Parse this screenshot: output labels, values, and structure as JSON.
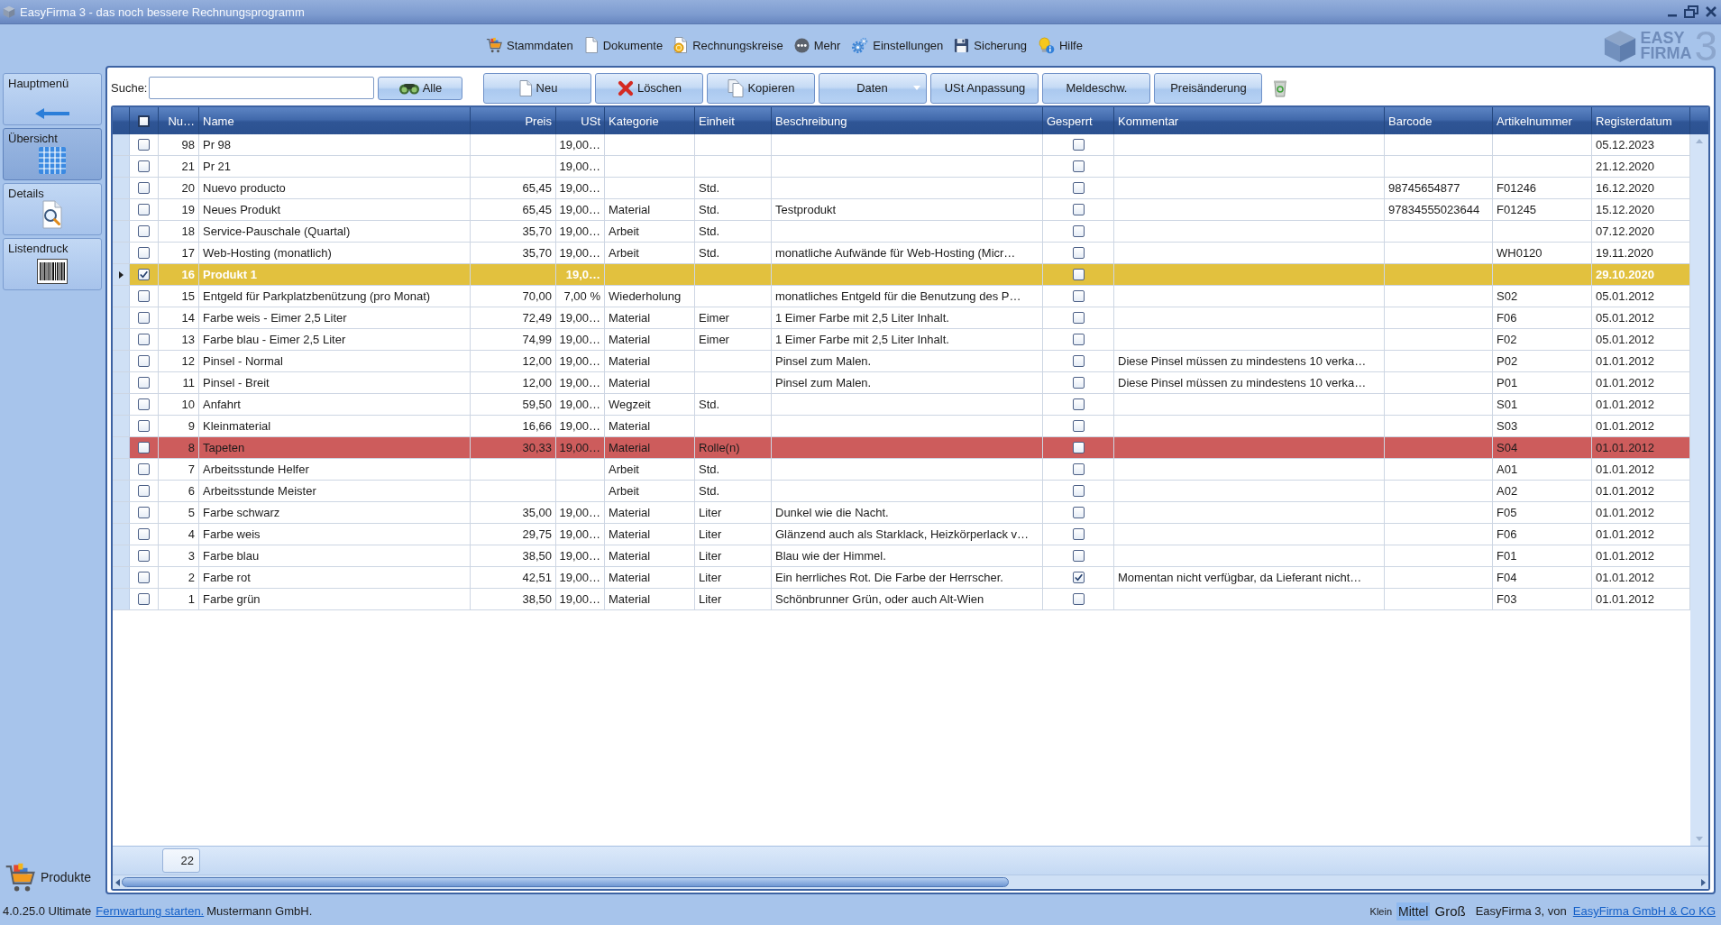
{
  "window": {
    "title": "EasyFirma 3 - das noch bessere Rechnungsprogramm"
  },
  "menu": [
    "Stammdaten",
    "Dokumente",
    "Rechnungskreise",
    "Mehr",
    "Einstellungen",
    "Sicherung",
    "Hilfe"
  ],
  "logo": {
    "words": [
      "EASY",
      "FIRMA"
    ],
    "numeral": "3"
  },
  "sidebar": {
    "items": [
      {
        "label": "Hauptmenü",
        "selected": false
      },
      {
        "label": "Übersicht",
        "selected": true
      },
      {
        "label": "Details",
        "selected": false
      },
      {
        "label": "Listendruck",
        "selected": false
      }
    ],
    "footer": "Produkte"
  },
  "toolbar": {
    "search_label": "Suche:",
    "filter_button": "Alle",
    "buttons": [
      {
        "label": "Neu",
        "kind": "button"
      },
      {
        "label": "Löschen",
        "kind": "button"
      },
      {
        "label": "Kopieren",
        "kind": "button"
      },
      {
        "label": "Daten",
        "kind": "dropdown"
      },
      {
        "label": "USt Anpassung",
        "kind": "button"
      },
      {
        "label": "Meldeschw.",
        "kind": "button"
      },
      {
        "label": "Preisänderung",
        "kind": "button"
      }
    ]
  },
  "table": {
    "select_all_checked": false,
    "columns": [
      "Nu…",
      "Name",
      "Preis",
      "USt",
      "Kategorie",
      "Einheit",
      "Beschreibung",
      "Gesperrt",
      "Kommentar",
      "Barcode",
      "Artikelnummer",
      "Registerdatum"
    ],
    "rows": [
      {
        "selected": false,
        "checked": false,
        "flagged": false,
        "nr": "98",
        "name": "Pr 98",
        "vat": "19,00…",
        "locked": false,
        "registered": "05.12.2023"
      },
      {
        "selected": false,
        "checked": false,
        "flagged": false,
        "nr": "21",
        "name": "Pr 21",
        "vat": "19,00…",
        "locked": false,
        "registered": "21.12.2020"
      },
      {
        "selected": false,
        "checked": false,
        "flagged": false,
        "nr": "20",
        "name": "Nuevo producto",
        "price": "65,45",
        "vat": "19,00…",
        "unit": "Std.",
        "locked": false,
        "barcode": "98745654877",
        "article_no": "F01246",
        "registered": "16.12.2020"
      },
      {
        "selected": false,
        "checked": false,
        "flagged": false,
        "nr": "19",
        "name": "Neues Produkt",
        "price": "65,45",
        "vat": "19,00…",
        "category": "Material",
        "unit": "Std.",
        "description": "Testprodukt",
        "locked": false,
        "barcode": "97834555023644",
        "article_no": "F01245",
        "registered": "15.12.2020"
      },
      {
        "selected": false,
        "checked": false,
        "flagged": false,
        "nr": "18",
        "name": "Service-Pauschale (Quartal)",
        "price": "35,70",
        "vat": "19,00…",
        "category": "Arbeit",
        "unit": "Std.",
        "locked": false,
        "registered": "07.12.2020"
      },
      {
        "selected": false,
        "checked": false,
        "flagged": false,
        "nr": "17",
        "name": "Web-Hosting (monatlich)",
        "price": "35,70",
        "vat": "19,00…",
        "category": "Arbeit",
        "unit": "Std.",
        "description": "monatliche Aufwände für Web-Hosting (Micr…",
        "locked": false,
        "article_no": "WH0120",
        "registered": "19.11.2020"
      },
      {
        "selected": true,
        "checked": true,
        "flagged": false,
        "nr": "16",
        "name": "Produkt 1",
        "vat": "19,0…",
        "locked": false,
        "registered": "29.10.2020"
      },
      {
        "selected": false,
        "checked": false,
        "flagged": false,
        "nr": "15",
        "name": "Entgeld für Parkplatzbenützung (pro Monat)",
        "price": "70,00",
        "vat": "7,00 %",
        "category": "Wiederholung",
        "description": "monatliches Entgeld für die Benutzung des P…",
        "locked": false,
        "article_no": "S02",
        "registered": "05.01.2012"
      },
      {
        "selected": false,
        "checked": false,
        "flagged": false,
        "nr": "14",
        "name": "Farbe weis - Eimer 2,5 Liter",
        "price": "72,49",
        "vat": "19,00…",
        "category": "Material",
        "unit": "Eimer",
        "description": "1 Eimer Farbe mit 2,5 Liter Inhalt.",
        "locked": false,
        "article_no": "F06",
        "registered": "05.01.2012"
      },
      {
        "selected": false,
        "checked": false,
        "flagged": false,
        "nr": "13",
        "name": "Farbe blau - Eimer 2,5 Liter",
        "price": "74,99",
        "vat": "19,00…",
        "category": "Material",
        "unit": "Eimer",
        "description": "1 Eimer Farbe mit 2,5 Liter Inhalt.",
        "locked": false,
        "article_no": "F02",
        "registered": "05.01.2012"
      },
      {
        "selected": false,
        "checked": false,
        "flagged": false,
        "nr": "12",
        "name": "Pinsel - Normal",
        "price": "12,00",
        "vat": "19,00…",
        "category": "Material",
        "description": "Pinsel zum Malen.",
        "locked": false,
        "comment": "Diese Pinsel müssen zu mindestens 10 verka…",
        "article_no": "P02",
        "registered": "01.01.2012"
      },
      {
        "selected": false,
        "checked": false,
        "flagged": false,
        "nr": "11",
        "name": "Pinsel - Breit",
        "price": "12,00",
        "vat": "19,00…",
        "category": "Material",
        "description": "Pinsel zum Malen.",
        "locked": false,
        "comment": "Diese Pinsel müssen zu mindestens 10 verka…",
        "article_no": "P01",
        "registered": "01.01.2012"
      },
      {
        "selected": false,
        "checked": false,
        "flagged": false,
        "nr": "10",
        "name": "Anfahrt",
        "price": "59,50",
        "vat": "19,00…",
        "category": "Wegzeit",
        "unit": "Std.",
        "locked": false,
        "article_no": "S01",
        "registered": "01.01.2012"
      },
      {
        "selected": false,
        "checked": false,
        "flagged": false,
        "nr": "9",
        "name": "Kleinmaterial",
        "price": "16,66",
        "vat": "19,00…",
        "category": "Material",
        "locked": false,
        "article_no": "S03",
        "registered": "01.01.2012"
      },
      {
        "selected": false,
        "checked": false,
        "flagged": true,
        "nr": "8",
        "name": "Tapeten",
        "price": "30,33",
        "vat": "19,00…",
        "category": "Material",
        "unit": "Rolle(n)",
        "locked": false,
        "article_no": "S04",
        "registered": "01.01.2012"
      },
      {
        "selected": false,
        "checked": false,
        "flagged": false,
        "nr": "7",
        "name": "Arbeitsstunde Helfer",
        "category": "Arbeit",
        "unit": "Std.",
        "locked": false,
        "article_no": "A01",
        "registered": "01.01.2012"
      },
      {
        "selected": false,
        "checked": false,
        "flagged": false,
        "nr": "6",
        "name": "Arbeitsstunde Meister",
        "category": "Arbeit",
        "unit": "Std.",
        "locked": false,
        "article_no": "A02",
        "registered": "01.01.2012"
      },
      {
        "selected": false,
        "checked": false,
        "flagged": false,
        "nr": "5",
        "name": "Farbe schwarz",
        "price": "35,00",
        "vat": "19,00…",
        "category": "Material",
        "unit": "Liter",
        "description": "Dunkel wie die Nacht.",
        "locked": false,
        "article_no": "F05",
        "registered": "01.01.2012"
      },
      {
        "selected": false,
        "checked": false,
        "flagged": false,
        "nr": "4",
        "name": "Farbe weis",
        "price": "29,75",
        "vat": "19,00…",
        "category": "Material",
        "unit": "Liter",
        "description": "Glänzend auch als Starklack, Heizkörperlack v…",
        "locked": false,
        "article_no": "F06",
        "registered": "01.01.2012"
      },
      {
        "selected": false,
        "checked": false,
        "flagged": false,
        "nr": "3",
        "name": "Farbe blau",
        "price": "38,50",
        "vat": "19,00…",
        "category": "Material",
        "unit": "Liter",
        "description": "Blau wie der Himmel.",
        "locked": false,
        "article_no": "F01",
        "registered": "01.01.2012"
      },
      {
        "selected": false,
        "checked": false,
        "flagged": false,
        "nr": "2",
        "name": "Farbe rot",
        "price": "42,51",
        "vat": "19,00…",
        "category": "Material",
        "unit": "Liter",
        "description": "Ein herrliches Rot. Die Farbe der Herrscher.",
        "locked": true,
        "comment": "Momentan nicht verfügbar, da Lieferant nicht…",
        "article_no": "F04",
        "registered": "01.01.2012"
      },
      {
        "selected": false,
        "checked": false,
        "flagged": false,
        "nr": "1",
        "name": "Farbe grün",
        "price": "38,50",
        "vat": "19,00…",
        "category": "Material",
        "unit": "Liter",
        "description": "Schönbrunner Grün, oder auch Alt-Wien",
        "locked": false,
        "article_no": "F03",
        "registered": "01.01.2012"
      }
    ],
    "row_count": "22"
  },
  "status_bar": {
    "version": "4.0.25.0 Ultimate",
    "remote_link": "Fernwartung starten.",
    "customer": "Mustermann GmbH.",
    "sizes": [
      {
        "label": "Klein",
        "selected": false
      },
      {
        "label": "Mittel",
        "selected": true
      },
      {
        "label": "Groß",
        "selected": false
      }
    ],
    "credit": "EasyFirma 3, von",
    "vendor_link": "EasyFirma GmbH & Co KG"
  }
}
